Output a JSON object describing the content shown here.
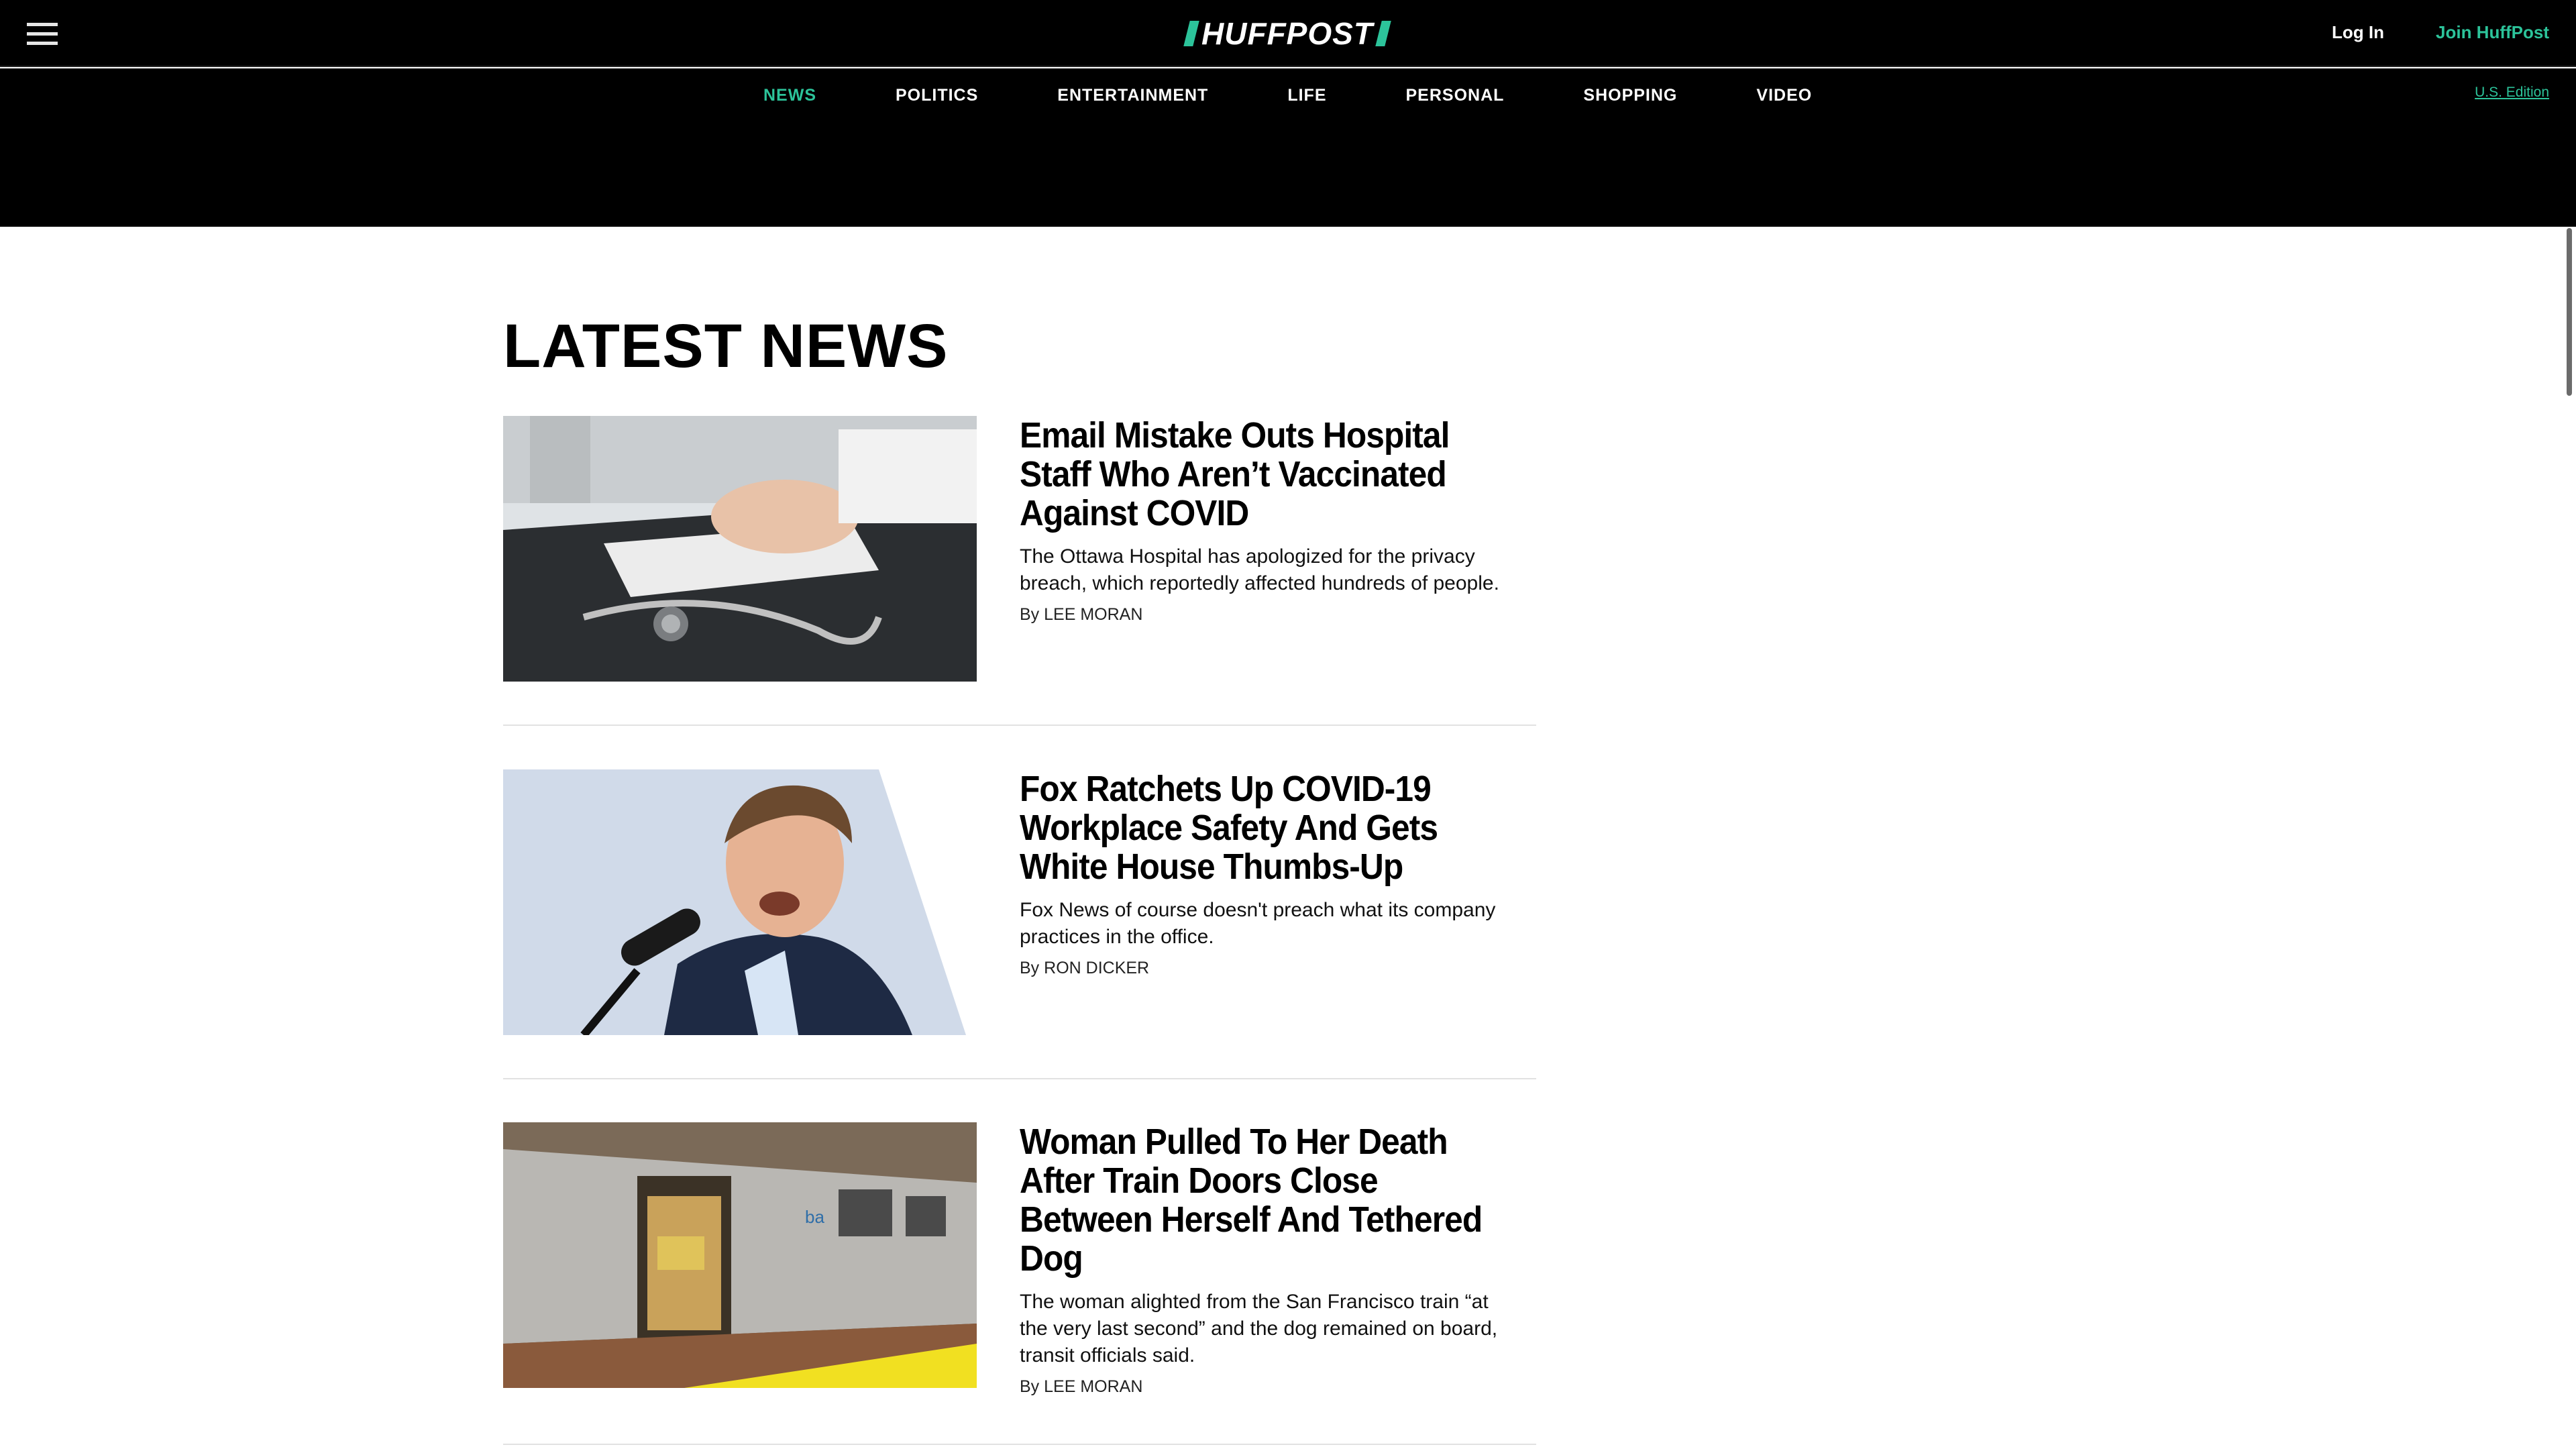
{
  "header": {
    "logo_text": "HUFFPOST",
    "login_label": "Log In",
    "join_label": "Join HuffPost",
    "edition_label": "U.S. Edition"
  },
  "nav": {
    "items": [
      {
        "label": "NEWS",
        "active": true
      },
      {
        "label": "POLITICS"
      },
      {
        "label": "ENTERTAINMENT"
      },
      {
        "label": "LIFE"
      },
      {
        "label": "PERSONAL"
      },
      {
        "label": "SHOPPING"
      },
      {
        "label": "VIDEO"
      }
    ]
  },
  "main": {
    "section_title": "LATEST NEWS",
    "byline_prefix": "By",
    "articles": [
      {
        "headline": "Email Mistake Outs Hospital Staff Who Aren’t Vaccinated Against COVID",
        "summary": "The Ottawa Hospital has apologized for the privacy breach, which reportedly affected hundreds of people.",
        "author": "LEE MORAN",
        "image": "keyboard-stethoscope-photo"
      },
      {
        "headline": "Fox Ratchets Up COVID-19 Workplace Safety And Gets White House Thumbs-Up",
        "summary": "Fox News of course doesn't preach what its company practices in the office.",
        "author": "RON DICKER",
        "image": "speaker-microphone-photo"
      },
      {
        "headline": "Woman Pulled To Her Death After Train Doors Close Between Herself And Tethered Dog",
        "summary": "The woman alighted from the San Francisco train “at the very last second” and the dog remained on board, transit officials said.",
        "author": "LEE MORAN",
        "image": "bart-train-photo"
      }
    ]
  },
  "colors": {
    "accent": "#2cc39a",
    "header_bg": "#000000"
  }
}
